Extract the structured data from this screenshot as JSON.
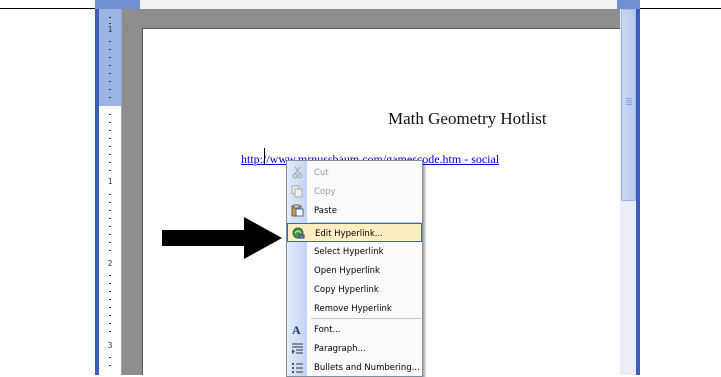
{
  "document": {
    "title": "Math Geometry Hotlist",
    "hyperlink_prefix": "http://",
    "hyperlink_rest": "www.mrnussbaum.com/gamescode.htm - social"
  },
  "ruler": {
    "numbers": [
      "1",
      "1",
      "2",
      "3"
    ]
  },
  "context_menu": {
    "items": [
      {
        "label": "Cut",
        "icon": "cut-icon",
        "enabled": false
      },
      {
        "label": "Copy",
        "icon": "copy-icon",
        "enabled": false
      },
      {
        "label": "Paste",
        "icon": "paste-icon",
        "enabled": true
      },
      {
        "label": "Edit Hyperlink...",
        "icon": "edit-hyperlink-icon",
        "enabled": true,
        "highlighted": true
      },
      {
        "label": "Select Hyperlink",
        "icon": "",
        "enabled": true
      },
      {
        "label": "Open Hyperlink",
        "icon": "",
        "enabled": true
      },
      {
        "label": "Copy Hyperlink",
        "icon": "",
        "enabled": true
      },
      {
        "label": "Remove Hyperlink",
        "icon": "",
        "enabled": true
      },
      {
        "label": "Font...",
        "icon": "font-icon",
        "enabled": true
      },
      {
        "label": "Paragraph...",
        "icon": "paragraph-icon",
        "enabled": true
      },
      {
        "label": "Bullets and Numbering...",
        "icon": "bullets-icon",
        "enabled": true
      }
    ]
  },
  "colors": {
    "hyperlink": "#0000ee",
    "menu_highlight": "#ffeec2",
    "menu_highlight_border": "#316ac5",
    "frame_blue": "#3a5fb8"
  }
}
